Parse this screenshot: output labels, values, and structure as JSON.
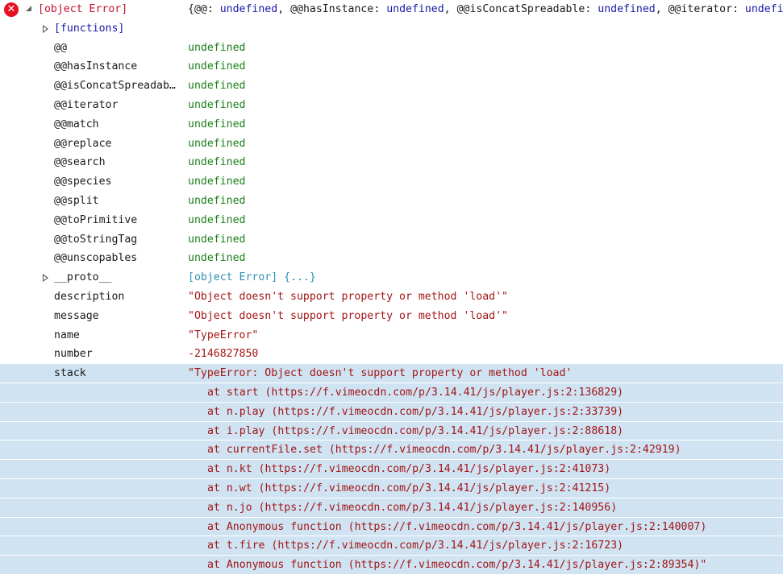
{
  "header": {
    "title": "[object Error]",
    "summary_open": "{",
    "summary_items": [
      {
        "key": "@@",
        "value": "undefined"
      },
      {
        "key": "@@hasInstance",
        "value": "undefined"
      },
      {
        "key": "@@isConcatSpreadable",
        "value": "undefined"
      },
      {
        "key": "@@iterator",
        "value": "undefined"
      }
    ],
    "summary_tail": "und"
  },
  "functions_label": "[functions]",
  "symbol_props": [
    {
      "key": "@@",
      "value": "undefined"
    },
    {
      "key": "@@hasInstance",
      "value": "undefined"
    },
    {
      "key": "@@isConcatSpreadable",
      "value": "undefined"
    },
    {
      "key": "@@iterator",
      "value": "undefined"
    },
    {
      "key": "@@match",
      "value": "undefined"
    },
    {
      "key": "@@replace",
      "value": "undefined"
    },
    {
      "key": "@@search",
      "value": "undefined"
    },
    {
      "key": "@@species",
      "value": "undefined"
    },
    {
      "key": "@@split",
      "value": "undefined"
    },
    {
      "key": "@@toPrimitive",
      "value": "undefined"
    },
    {
      "key": "@@toStringTag",
      "value": "undefined"
    },
    {
      "key": "@@unscopables",
      "value": "undefined"
    }
  ],
  "proto": {
    "key": "__proto__",
    "value": "[object Error] {...}"
  },
  "props": [
    {
      "key": "description",
      "value": "\"Object doesn't support property or method 'load'\"",
      "kind": "str"
    },
    {
      "key": "message",
      "value": "\"Object doesn't support property or method 'load'\"",
      "kind": "str"
    },
    {
      "key": "name",
      "value": "\"TypeError\"",
      "kind": "str"
    },
    {
      "key": "number",
      "value": "-2146827850",
      "kind": "num"
    }
  ],
  "stack": {
    "key": "stack",
    "first_line": "\"TypeError: Object doesn't support property or method 'load'",
    "frames": [
      "at start (https://f.vimeocdn.com/p/3.14.41/js/player.js:2:136829)",
      "at n.play (https://f.vimeocdn.com/p/3.14.41/js/player.js:2:33739)",
      "at i.play (https://f.vimeocdn.com/p/3.14.41/js/player.js:2:88618)",
      "at currentFile.set (https://f.vimeocdn.com/p/3.14.41/js/player.js:2:42919)",
      "at n.kt (https://f.vimeocdn.com/p/3.14.41/js/player.js:2:41073)",
      "at n.wt (https://f.vimeocdn.com/p/3.14.41/js/player.js:2:41215)",
      "at n.jo (https://f.vimeocdn.com/p/3.14.41/js/player.js:2:140956)",
      "at Anonymous function (https://f.vimeocdn.com/p/3.14.41/js/player.js:2:140007)",
      "at t.fire (https://f.vimeocdn.com/p/3.14.41/js/player.js:2:16723)",
      "at Anonymous function (https://f.vimeocdn.com/p/3.14.41/js/player.js:2:89354)\""
    ]
  },
  "icons": {
    "error": "error-icon",
    "expanded": "caret-down-icon",
    "collapsed": "caret-right-icon"
  },
  "colors": {
    "error_red": "#e81123",
    "title_red": "#c5112b",
    "undefined_green": "#1a7f1a",
    "string_red": "#a31515",
    "keyword_blue": "#1a1aa6",
    "link_teal": "#2f8fb3",
    "highlight": "#cfe3f2"
  }
}
